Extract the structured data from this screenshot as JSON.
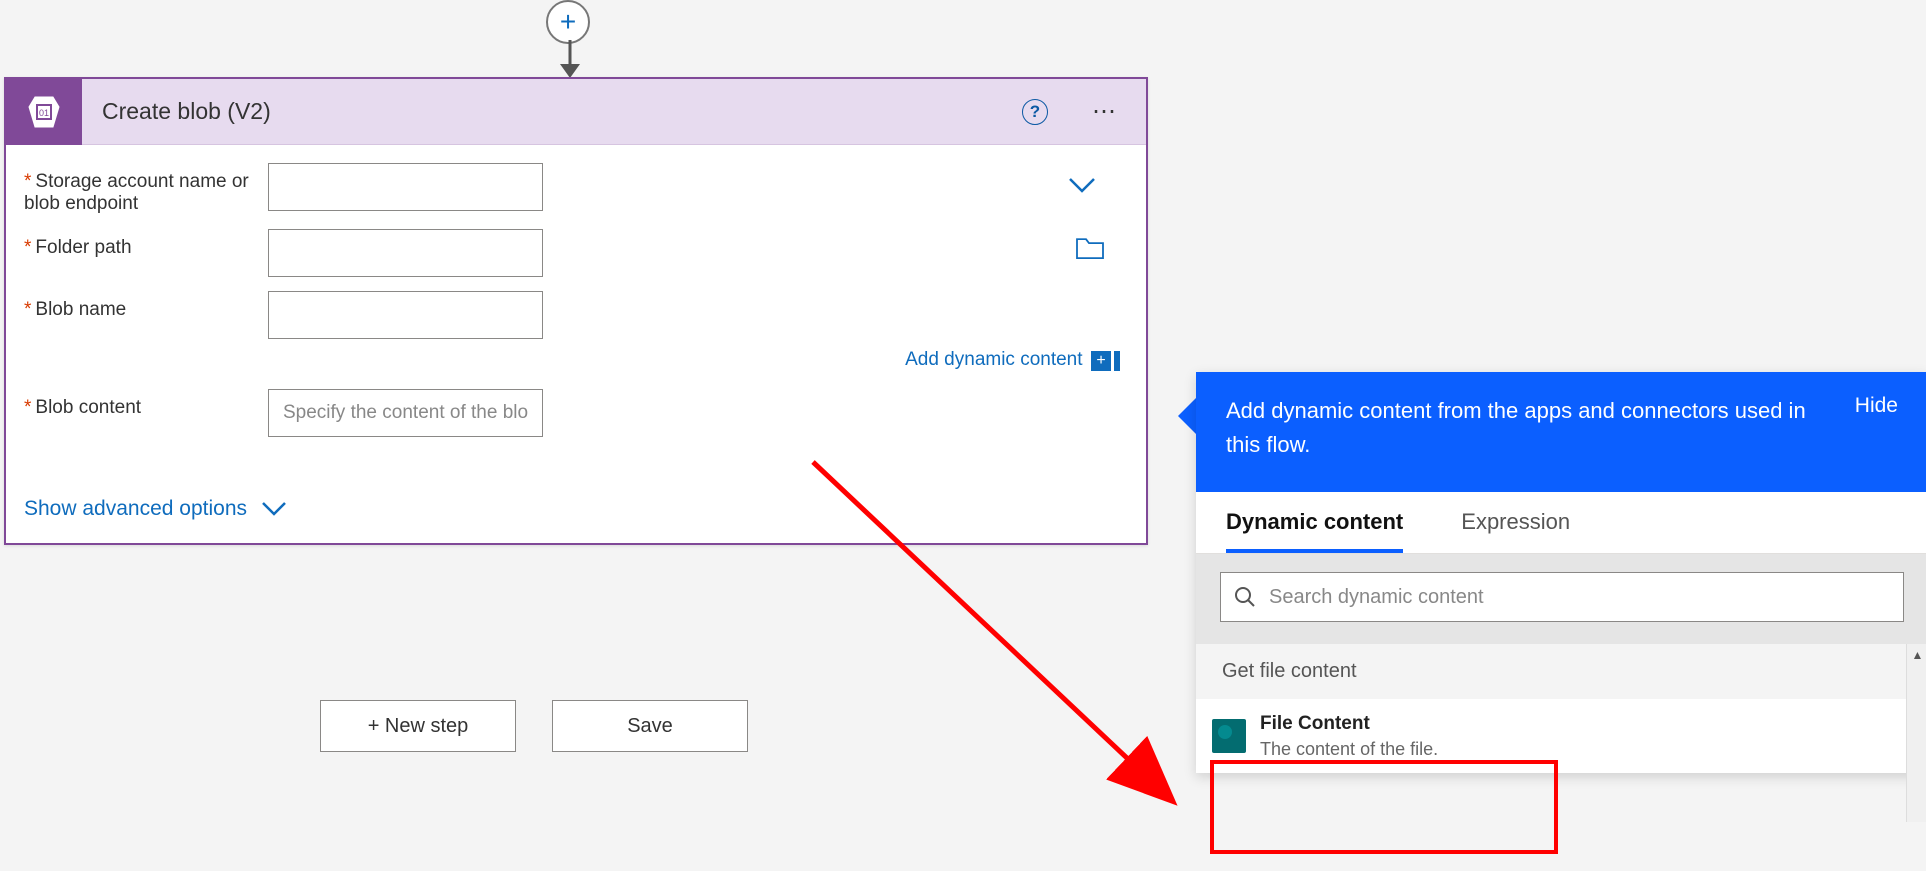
{
  "action": {
    "title": "Create blob (V2)",
    "fields": {
      "storage": {
        "label": "Storage account name or blob endpoint",
        "value": "",
        "required": true
      },
      "folder": {
        "label": "Folder path",
        "value": "",
        "required": true
      },
      "blobname": {
        "label": "Blob name",
        "value": "",
        "required": true
      },
      "content": {
        "label": "Blob content",
        "placeholder": "Specify the content of the blob to upload.",
        "value": "",
        "required": true
      }
    },
    "addDynamicLabel": "Add dynamic content",
    "showAdvanced": "Show advanced options"
  },
  "buttons": {
    "newStep": "+ New step",
    "save": "Save"
  },
  "dynamicContent": {
    "headerText": "Add dynamic content from the apps and connectors used in this flow.",
    "hide": "Hide",
    "tabs": {
      "dynamic": "Dynamic content",
      "expression": "Expression"
    },
    "searchPlaceholder": "Search dynamic content",
    "sectionTitle": "Get file content",
    "item": {
      "title": "File Content",
      "subtitle": "The content of the file."
    }
  }
}
